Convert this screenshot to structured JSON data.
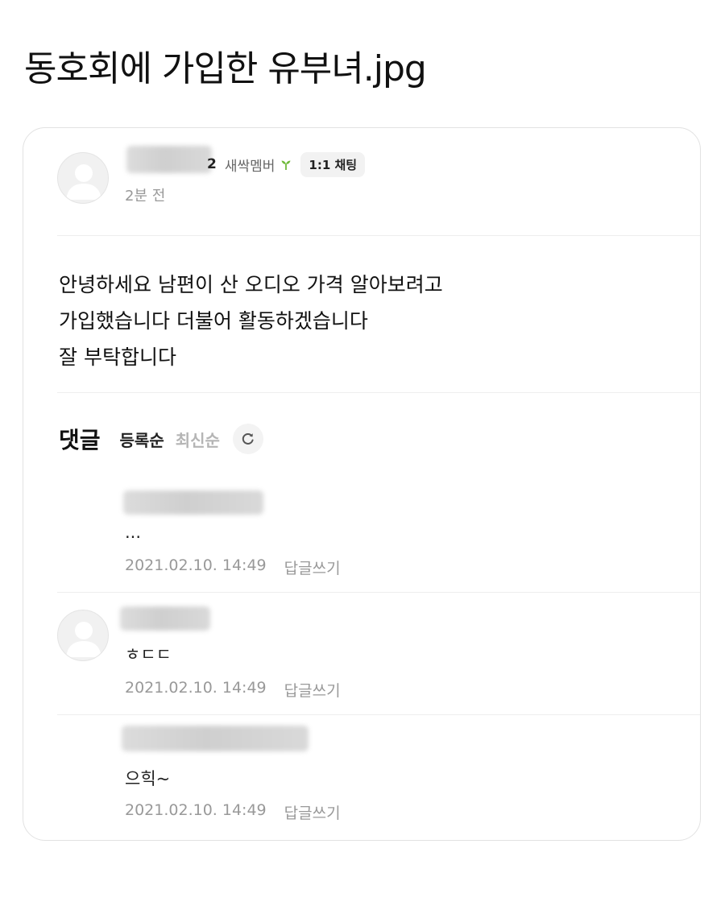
{
  "page_title": "동호회에 가입한 유부녀.jpg",
  "post": {
    "author_name_suffix": "2",
    "member_grade": "새싹멤버",
    "chat_button_label": "1:1 채팅",
    "time_ago": "2분 전",
    "body_lines": [
      "안녕하세요 남편이 산 오디오 가격 알아보려고",
      "가입했습니다 더불어 활동하겠습니다",
      "잘 부탁합니다"
    ]
  },
  "comments_section": {
    "title": "댓글",
    "sort_options": [
      "등록순",
      "최신순"
    ],
    "active_sort": "등록순",
    "refresh_icon": "refresh-icon"
  },
  "comments": [
    {
      "text": "...",
      "date": "2021.02.10. 14:49",
      "reply_label": "답글쓰기",
      "is_reply": true
    },
    {
      "text": "ㅎㄷㄷ",
      "date": "2021.02.10. 14:49",
      "reply_label": "답글쓰기",
      "is_reply": false
    },
    {
      "text": "으힉~",
      "date": "2021.02.10. 14:49",
      "reply_label": "답글쓰기",
      "is_reply": true
    }
  ],
  "colors": {
    "card_border": "#e2e2e2",
    "muted_text": "#999999",
    "sprout_green": "#6fba3a"
  }
}
